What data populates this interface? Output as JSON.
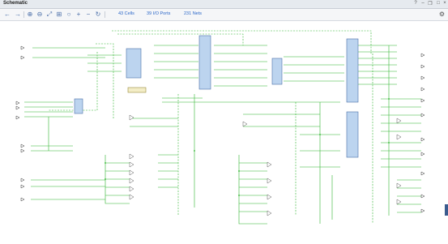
{
  "window": {
    "title": "Schematic"
  },
  "toolbar": {
    "cells_label": "43 Cells",
    "io_ports_label": "39 I/O Ports",
    "nets_label": "231 Nets"
  },
  "colors": {
    "net": "#2fb52f",
    "cell_fill": "#bcd4ef",
    "cell_border": "#4a6ea8",
    "link": "#2a66c8"
  },
  "icons": [
    "back-icon",
    "forward-icon",
    "zoom-in-icon",
    "zoom-out-icon",
    "fit-icon",
    "zoom-area-icon",
    "select-icon",
    "add-icon",
    "minus-icon",
    "refresh-icon",
    "gear-icon"
  ]
}
